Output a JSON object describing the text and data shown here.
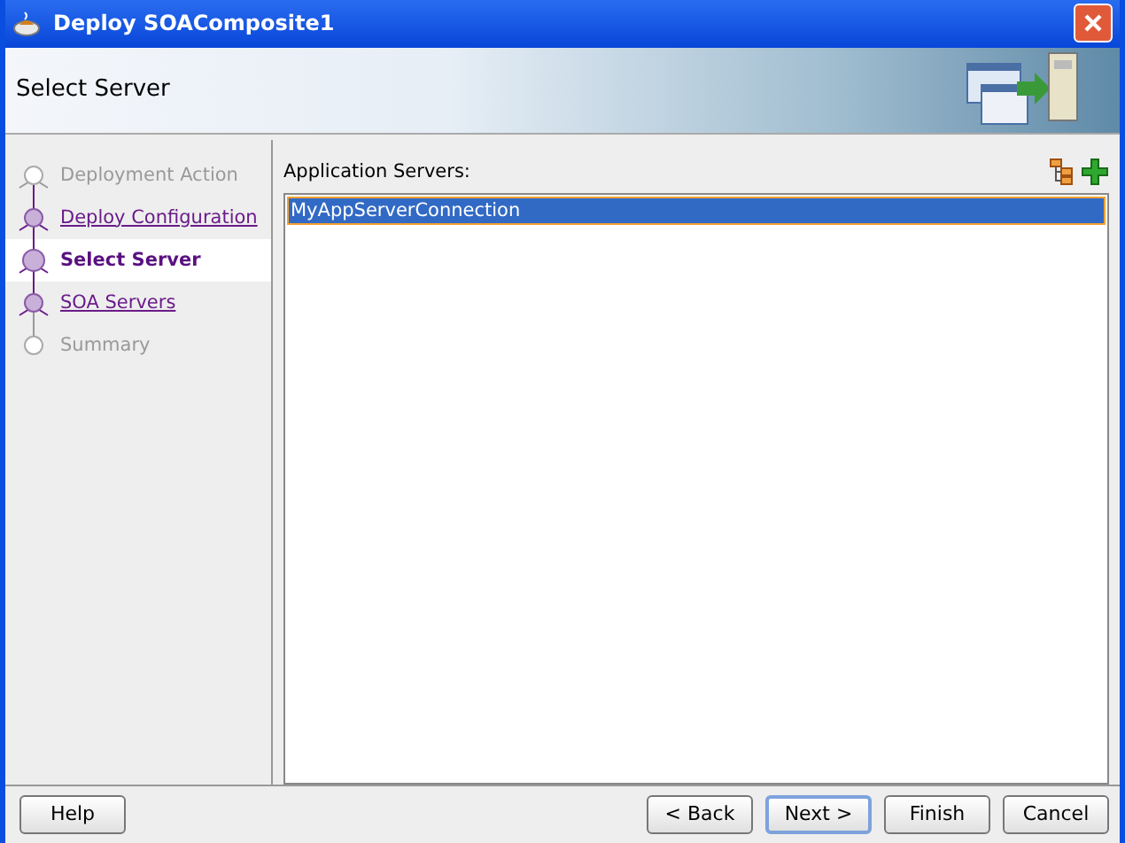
{
  "window": {
    "title": "Deploy SOAComposite1"
  },
  "header": {
    "title": "Select Server"
  },
  "steps": [
    {
      "label": "Deployment Action",
      "kind": "disabled",
      "selected": false
    },
    {
      "label": "Deploy Configuration",
      "kind": "link",
      "selected": false
    },
    {
      "label": "Select Server",
      "kind": "current",
      "selected": true
    },
    {
      "label": "SOA Servers",
      "kind": "link",
      "selected": false
    },
    {
      "label": "Summary",
      "kind": "disabled",
      "selected": false
    }
  ],
  "servers": {
    "label": "Application Servers:",
    "items": [
      {
        "name": "MyAppServerConnection",
        "selected": true
      }
    ]
  },
  "buttons": [
    {
      "label": "Help",
      "default": false
    },
    {
      "label": "< Back",
      "default": false
    },
    {
      "label": "Next >",
      "default": true
    },
    {
      "label": "Finish",
      "default": false
    },
    {
      "label": "Cancel",
      "default": false
    }
  ]
}
